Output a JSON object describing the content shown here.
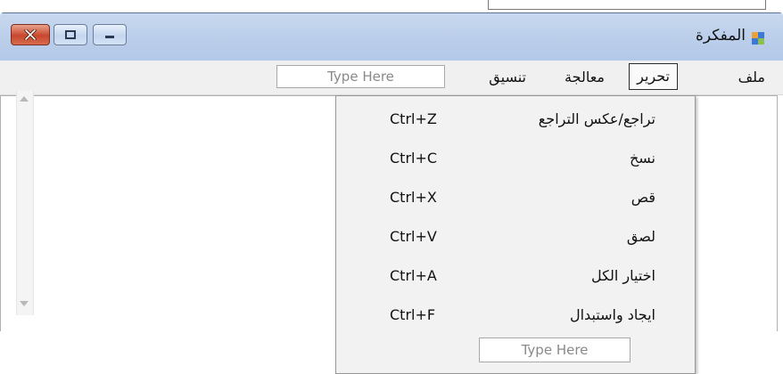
{
  "window": {
    "title": "المفكرة",
    "buttons": [
      "close",
      "maximize",
      "minimize"
    ]
  },
  "menubar": {
    "file": "ملف",
    "edit": "تحرير",
    "process": "معالجة",
    "format": "تنسيق",
    "type_here": "Type Here"
  },
  "edit_menu": {
    "items": [
      {
        "label": "تراجع/عكس التراجع",
        "shortcut": "Ctrl+Z"
      },
      {
        "label": "نسخ",
        "shortcut": "Ctrl+C"
      },
      {
        "label": "قص",
        "shortcut": "Ctrl+X"
      },
      {
        "label": "لصق",
        "shortcut": "Ctrl+V"
      },
      {
        "label": "اختيار الكل",
        "shortcut": "Ctrl+A"
      },
      {
        "label": "ايجاد واستبدال",
        "shortcut": "Ctrl+F"
      }
    ],
    "type_here": "Type Here"
  },
  "colors": {
    "titlebar": "#bccfeb",
    "close_button": "#c8462c",
    "menu_background": "#f2f2f2"
  }
}
